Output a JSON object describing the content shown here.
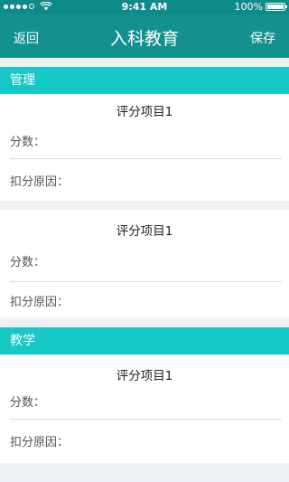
{
  "status_bar": {
    "time": "9:41 AM",
    "battery": "100%"
  },
  "nav": {
    "back": "返回",
    "title": "入科教育",
    "save": "保存"
  },
  "sections": [
    {
      "header": "管理",
      "items": [
        {
          "title": "评分项目1",
          "score_label": "分数：",
          "reason_label": "扣分原因："
        },
        {
          "title": "评分项目1",
          "score_label": "分数：",
          "reason_label": "扣分原因："
        }
      ]
    },
    {
      "header": "教学",
      "items": [
        {
          "title": "评分项目1",
          "score_label": "分数：",
          "reason_label": "扣分原因："
        }
      ]
    }
  ],
  "colors": {
    "nav_bg": "#12918e",
    "section_header_bg": "#16c9c6",
    "page_bg": "#eef1f3"
  }
}
